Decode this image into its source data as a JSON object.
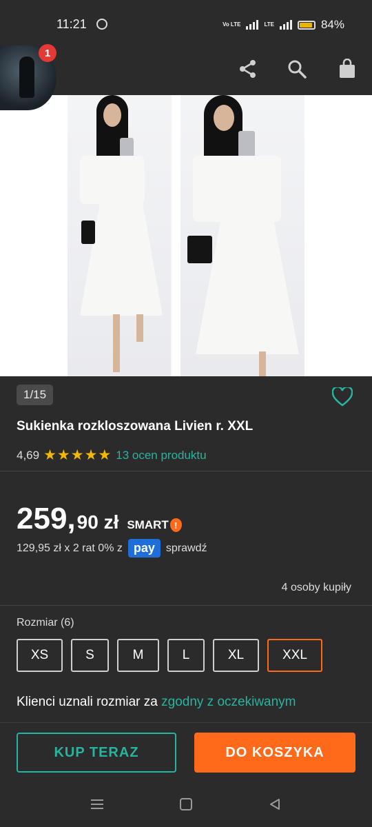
{
  "status_bar": {
    "time": "11:21",
    "network_label": "Vo LTE",
    "lte_label": "LTE",
    "battery": "84%"
  },
  "notifications": {
    "badge_count": "1"
  },
  "gallery": {
    "counter": "1/15"
  },
  "product": {
    "title": "Sukienka rozkloszowana Livien r. XXL",
    "rating_value": "4,69",
    "stars": "★★★★★",
    "reviews_link": "13 ocen produktu",
    "price_main": "259,",
    "price_rest": "90 zł",
    "smart_label": "SMART",
    "installment_text": "129,95 zł x 2 rat 0% z",
    "pay_label": "pay",
    "check_label": "sprawdź",
    "buyers": "4 osoby kupiły"
  },
  "size": {
    "label": "Rozmiar (6)",
    "options": [
      "XS",
      "S",
      "M",
      "L",
      "XL",
      "XXL"
    ],
    "selected": "XXL"
  },
  "fit": {
    "prefix": "Klienci uznali rozmiar  za",
    "value": "zgodny z oczekiwanym"
  },
  "actions": {
    "buy_now": "KUP TERAZ",
    "add_to_cart": "DO KOSZYKA"
  },
  "colors": {
    "accent_teal": "#26b5a0",
    "accent_orange": "#ff6a1a",
    "star_yellow": "#f5b800",
    "background": "#2b2b2b"
  }
}
